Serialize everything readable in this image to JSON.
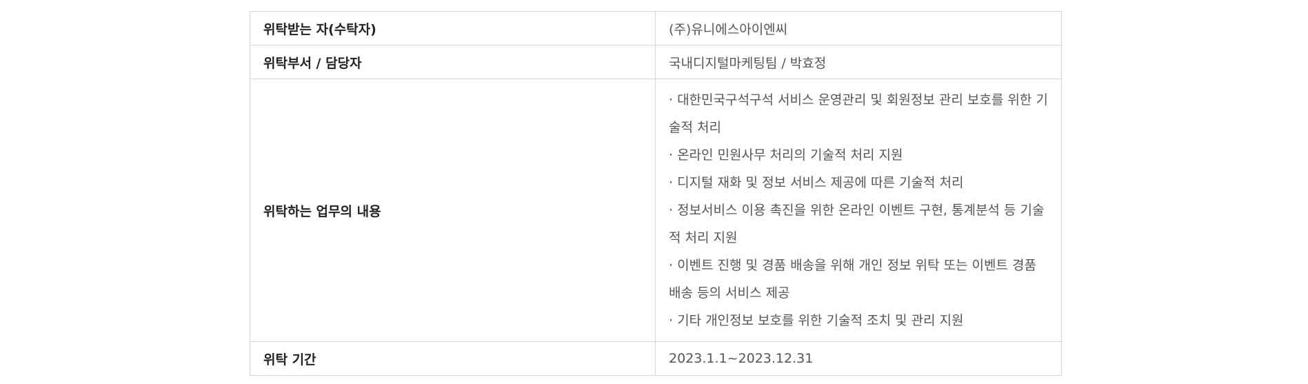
{
  "rows": [
    {
      "label": "위탁받는 자(수탁자)",
      "value": "(주)유니에스아이엔씨"
    },
    {
      "label": "위탁부서 / 담당자",
      "value": "국내디지털마케팅팀 / 박효정"
    },
    {
      "label": "위탁하는 업무의 내용",
      "items": [
        "· 대한민국구석구석 서비스 운영관리 및 회원정보 관리 보호를 위한 기술적 처리",
        "· 온라인 민원사무 처리의 기술적 처리 지원",
        "· 디지털 재화 및 정보 서비스 제공에 따른 기술적 처리",
        "· 정보서비스 이용 촉진을 위한 온라인 이벤트 구현, 통계분석 등 기술적 처리 지원",
        "· 이벤트 진행 및 경품 배송을 위해 개인 정보 위탁 또는 이벤트 경품 배송 등의 서비스 제공",
        "· 기타 개인정보 보호를 위한 기술적 조치 및 관리 지원"
      ]
    },
    {
      "label": "위탁 기간",
      "value": "2023.1.1~2023.12.31"
    }
  ]
}
